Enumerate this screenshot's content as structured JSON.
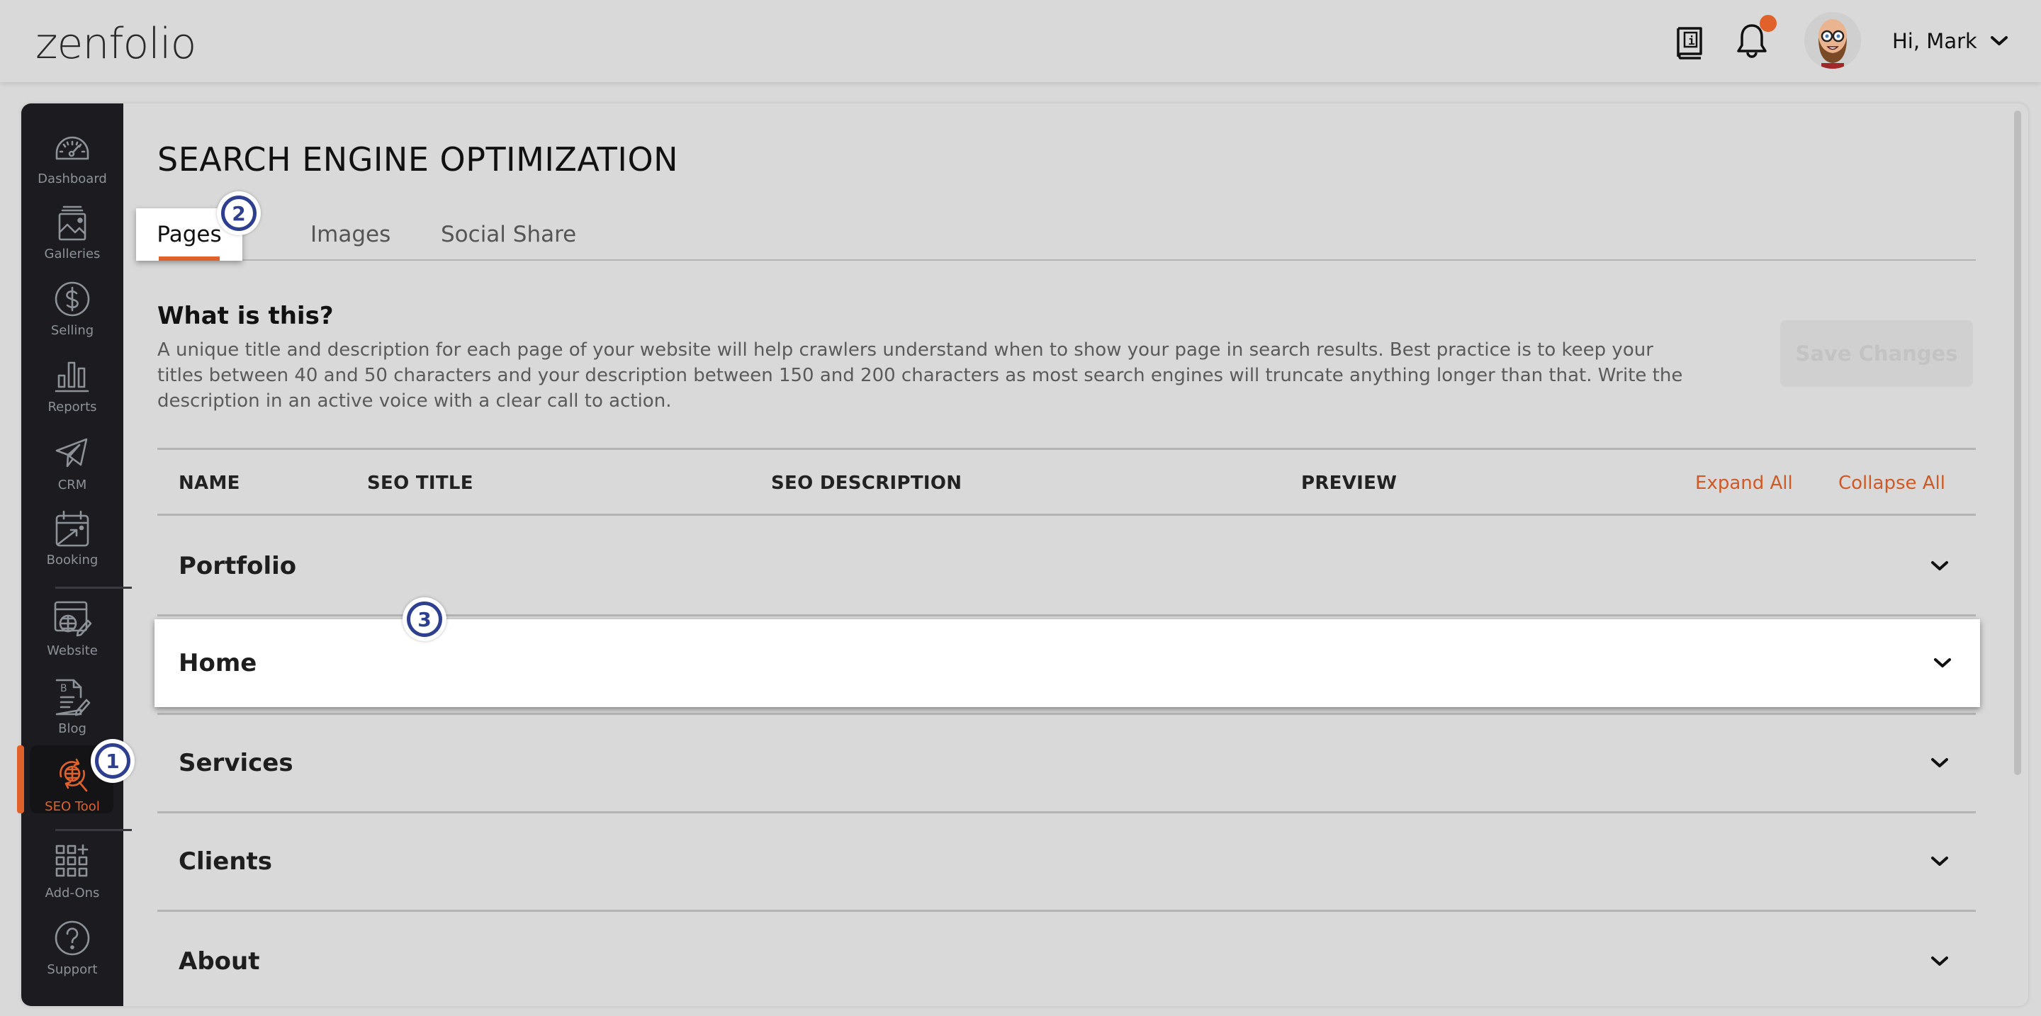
{
  "header": {
    "logo_text": "zenfolio",
    "greeting": "Hi, Mark",
    "icons": {
      "guide": "book-info-icon",
      "notifications": "bell-icon",
      "notification_dot_color": "#e0622a",
      "avatar": "user-avatar",
      "menu": "chevron-down-icon"
    }
  },
  "sidebar": {
    "items": [
      {
        "label": "Dashboard",
        "icon": "speedometer-icon",
        "active": false
      },
      {
        "label": "Galleries",
        "icon": "gallery-icon",
        "active": false
      },
      {
        "label": "Selling",
        "icon": "dollar-icon",
        "active": false
      },
      {
        "label": "Reports",
        "icon": "bar-chart-icon",
        "active": false
      },
      {
        "label": "CRM",
        "icon": "paper-plane-icon",
        "active": false
      },
      {
        "label": "Booking",
        "icon": "calendar-icon",
        "active": false
      },
      {
        "label": "Website",
        "icon": "website-edit-icon",
        "active": false
      },
      {
        "label": "Blog",
        "icon": "blog-edit-icon",
        "active": false
      },
      {
        "label": "SEO Tool",
        "icon": "seo-globe-icon",
        "active": true
      },
      {
        "label": "Add-Ons",
        "icon": "add-ons-grid-icon",
        "active": false
      },
      {
        "label": "Support",
        "icon": "help-icon",
        "active": false
      }
    ]
  },
  "main": {
    "title": "SEARCH ENGINE OPTIMIZATION",
    "tabs": [
      {
        "label": "Pages",
        "active": true
      },
      {
        "label": "Images",
        "active": false
      },
      {
        "label": "Social Share",
        "active": false
      }
    ],
    "info": {
      "heading": "What is this?",
      "description": "A unique title and description for each page of your website will help crawlers understand when to show your page in search results. Best practice is to keep your titles between 40 and 50 characters and your description between 150 and 200 characters as most search engines will truncate anything longer than that. Write the description in an active voice with a clear call to action."
    },
    "save_button": {
      "label": "Save Changes",
      "enabled": false
    },
    "table": {
      "columns": [
        "NAME",
        "SEO TITLE",
        "SEO DESCRIPTION",
        "PREVIEW"
      ],
      "expand_all": "Expand All",
      "collapse_all": "Collapse All",
      "rows": [
        {
          "name": "Portfolio",
          "highlighted": false
        },
        {
          "name": "Home",
          "highlighted": true
        },
        {
          "name": "Services",
          "highlighted": false
        },
        {
          "name": "Clients",
          "highlighted": false
        },
        {
          "name": "About",
          "highlighted": false
        }
      ]
    }
  },
  "annotations": [
    "1",
    "2",
    "3"
  ],
  "colors": {
    "accent": "#e0622a",
    "sidebar_bg": "#1c1c20",
    "annotation": "#2e3f8f"
  }
}
